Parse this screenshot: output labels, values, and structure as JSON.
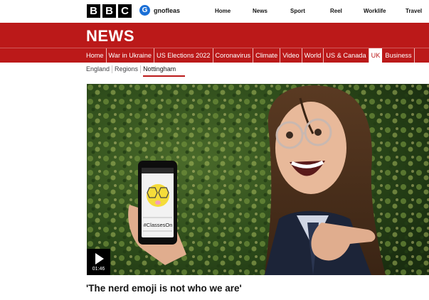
{
  "header": {
    "logo_letters": [
      "B",
      "B",
      "C"
    ],
    "account_initial": "G",
    "account_name": "gnofleas",
    "nav": [
      "Home",
      "News",
      "Sport",
      "Reel",
      "Worklife",
      "Travel"
    ]
  },
  "news_bar": {
    "title": "NEWS",
    "items": [
      "Home",
      "War in Ukraine",
      "US Elections 2022",
      "Coronavirus",
      "Climate",
      "Video",
      "World",
      "US & Canada",
      "UK",
      "Business"
    ],
    "active": "UK"
  },
  "region_nav": {
    "items": [
      "England",
      "Regions",
      "Nottingham"
    ],
    "current": "Nottingham"
  },
  "media": {
    "phone_caption": "#ClassesOn",
    "duration": "01:46"
  },
  "article": {
    "headline": "'The nerd emoji is not who we are'"
  },
  "colors": {
    "brand_red": "#bb1919",
    "account_blue": "#1a6fd6"
  }
}
